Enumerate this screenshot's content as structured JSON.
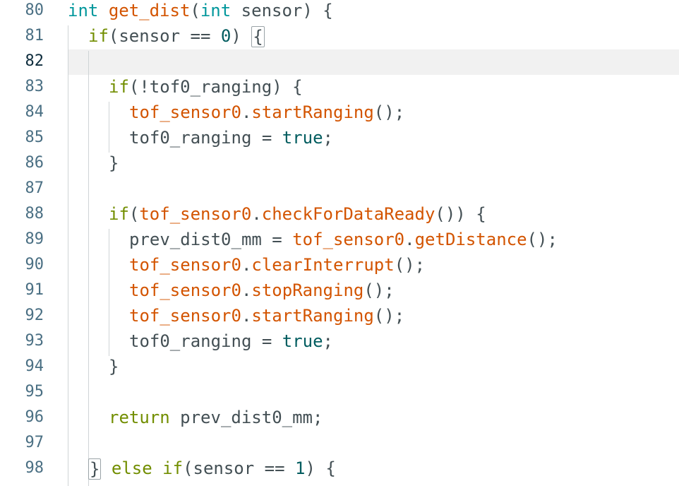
{
  "line_numbers": [
    "80",
    "81",
    "82",
    "83",
    "84",
    "85",
    "86",
    "87",
    "88",
    "89",
    "90",
    "91",
    "92",
    "93",
    "94",
    "95",
    "96",
    "97",
    "98"
  ],
  "code": {
    "l80": {
      "t1": "int",
      "t2": "get_dist",
      "t3": "(",
      "t4": "int",
      "t5": " sensor) {"
    },
    "l81": {
      "t1": "if",
      "t2": "(sensor == ",
      "t3": "0",
      "t4": ") ",
      "t5": "{"
    },
    "l83": {
      "t1": "if",
      "t2": "(!tof0_ranging) {"
    },
    "l84": {
      "t1": "tof_sensor0",
      "t2": ".",
      "t3": "startRanging",
      "t4": "();"
    },
    "l85": {
      "t1": "tof0_ranging = ",
      "t2": "true",
      "t3": ";"
    },
    "l86": {
      "t1": "}"
    },
    "l88": {
      "t1": "if",
      "t2": "(",
      "t3": "tof_sensor0",
      "t4": ".",
      "t5": "checkForDataReady",
      "t6": "()) {"
    },
    "l89": {
      "t1": "prev_dist0_mm = ",
      "t2": "tof_sensor0",
      "t3": ".",
      "t4": "getDistance",
      "t5": "();"
    },
    "l90": {
      "t1": "tof_sensor0",
      "t2": ".",
      "t3": "clearInterrupt",
      "t4": "();"
    },
    "l91": {
      "t1": "tof_sensor0",
      "t2": ".",
      "t3": "stopRanging",
      "t4": "();"
    },
    "l92": {
      "t1": "tof_sensor0",
      "t2": ".",
      "t3": "startRanging",
      "t4": "();"
    },
    "l93": {
      "t1": "tof0_ranging = ",
      "t2": "true",
      "t3": ";"
    },
    "l94": {
      "t1": "}"
    },
    "l96": {
      "t1": "return",
      "t2": " prev_dist0_mm;"
    },
    "l98": {
      "t1": "}",
      "t2": " ",
      "t3": "else",
      "t4": " ",
      "t5": "if",
      "t6": "(sensor == ",
      "t7": "1",
      "t8": ") {"
    }
  },
  "colors": {
    "keyword": "#728e00",
    "type": "#00979c",
    "function": "#d35400",
    "constant": "#005c5f",
    "text": "#434f54",
    "line_number": "#4a6f83",
    "current_line": "#f1f1f1"
  }
}
